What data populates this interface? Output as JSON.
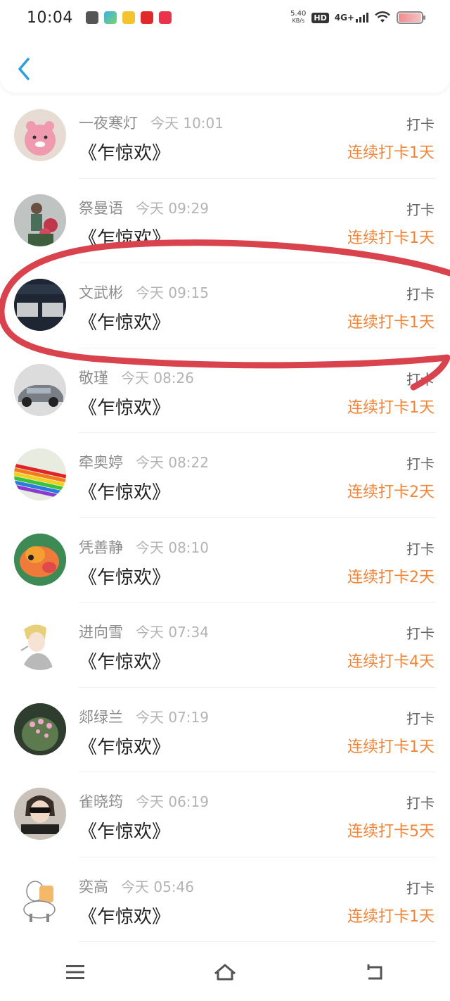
{
  "status_bar": {
    "time": "10:04",
    "net_speed_value": "5.40",
    "net_speed_unit": "KB/s",
    "hd": "HD",
    "network": "4G+",
    "notification_icons": [
      "app-icon-1",
      "app-icon-2",
      "app-icon-3",
      "app-icon-4",
      "app-icon-5"
    ]
  },
  "header": {
    "back_icon": "chevron-left-icon"
  },
  "list": {
    "items": [
      {
        "name": "一夜寒灯",
        "time": "今天 10:01",
        "song": "《乍惊欢》",
        "action": "打卡",
        "streak": "连续打卡1天"
      },
      {
        "name": "祭曼语",
        "time": "今天 09:29",
        "song": "《乍惊欢》",
        "action": "打卡",
        "streak": "连续打卡1天"
      },
      {
        "name": "文武彬",
        "time": "今天 09:15",
        "song": "《乍惊欢》",
        "action": "打卡",
        "streak": "连续打卡1天"
      },
      {
        "name": "敬瑾",
        "time": "今天 08:26",
        "song": "《乍惊欢》",
        "action": "打卡",
        "streak": "连续打卡1天"
      },
      {
        "name": "牵奥婷",
        "time": "今天 08:22",
        "song": "《乍惊欢》",
        "action": "打卡",
        "streak": "连续打卡2天"
      },
      {
        "name": "凭善静",
        "time": "今天 08:10",
        "song": "《乍惊欢》",
        "action": "打卡",
        "streak": "连续打卡2天"
      },
      {
        "name": "进向雪",
        "time": "今天 07:34",
        "song": "《乍惊欢》",
        "action": "打卡",
        "streak": "连续打卡4天"
      },
      {
        "name": "郯绿兰",
        "time": "今天 07:19",
        "song": "《乍惊欢》",
        "action": "打卡",
        "streak": "连续打卡1天"
      },
      {
        "name": "雀晓筠",
        "time": "今天 06:19",
        "song": "《乍惊欢》",
        "action": "打卡",
        "streak": "连续打卡5天"
      },
      {
        "name": "奕高",
        "time": "今天 05:46",
        "song": "《乍惊欢》",
        "action": "打卡",
        "streak": "连续打卡1天"
      }
    ]
  },
  "nav_bar": {
    "menu_icon": "menu-icon",
    "home_icon": "home-icon",
    "back_icon": "back-icon"
  },
  "colors": {
    "streak": "#f0853a",
    "annotation": "#d9434e"
  }
}
